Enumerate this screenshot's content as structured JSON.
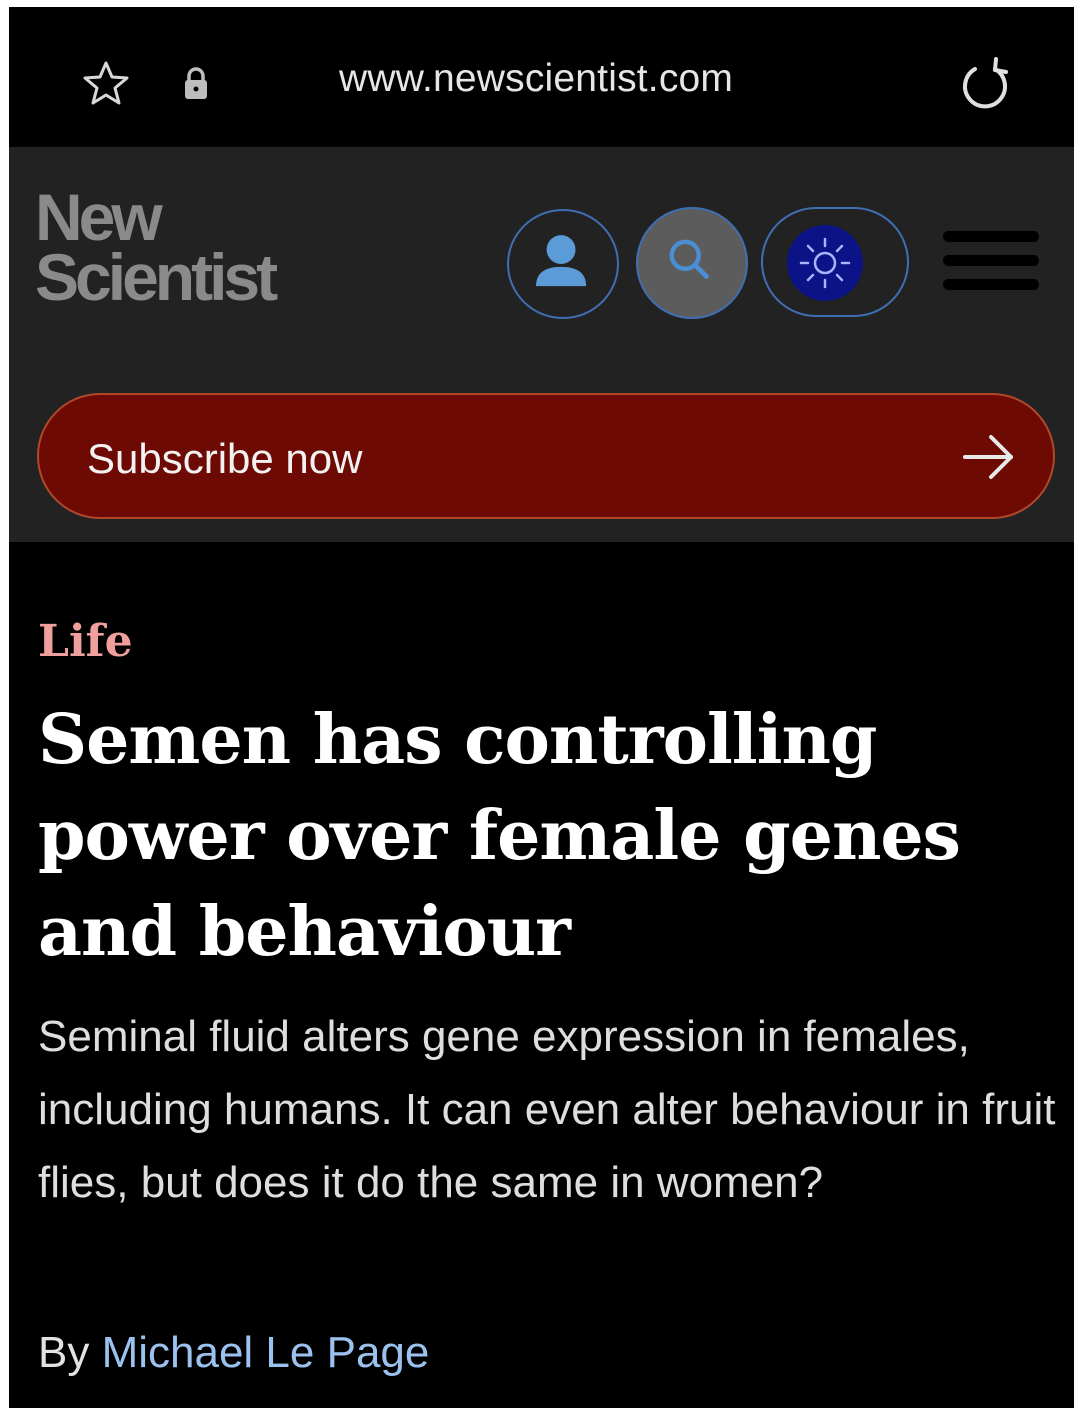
{
  "browser": {
    "url": "www.newscientist.com",
    "icons": [
      "star-icon",
      "lock-icon",
      "reload-icon"
    ]
  },
  "site": {
    "logo_line1": "New",
    "logo_line2": "Scientist",
    "header_buttons": [
      "user-icon",
      "search-icon",
      "sun-icon",
      "hamburger-menu-icon"
    ],
    "subscribe_label": "Subscribe now",
    "colors": {
      "header_bg": "#222222",
      "subscribe_bg": "#6e0a04",
      "accent_blue": "#3f6fb2",
      "category": "#f0a09c",
      "author_link": "#9bc2ef"
    }
  },
  "article": {
    "category": "Life",
    "headline": "Semen has controlling power over female genes and behaviour",
    "standfirst": "Seminal fluid alters gene expression in females, including humans. It can even alter behaviour in fruit flies, but does it do the same in women?",
    "byline_prefix": "By",
    "author": "Michael Le Page"
  }
}
